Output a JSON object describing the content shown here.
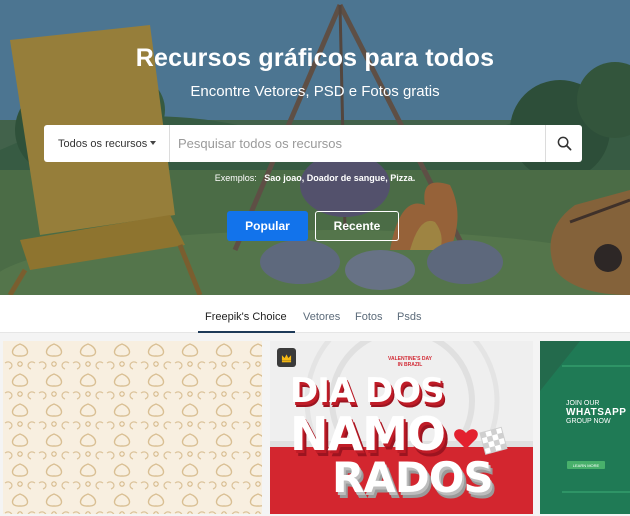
{
  "hero": {
    "title": "Recursos gráficos para todos",
    "subtitle": "Encontre Vetores, PSD e Fotos gratis"
  },
  "search": {
    "category": "Todos os recursos",
    "placeholder": "Pesquisar todos os recursos",
    "icon": "search-icon"
  },
  "examples": {
    "label": "Exemplos:",
    "items": "Sao joao, Doador de sangue, Pizza."
  },
  "buttons": {
    "popular": "Popular",
    "recent": "Recente"
  },
  "tabs": [
    {
      "label": "Freepik's Choice",
      "active": true
    },
    {
      "label": "Vetores",
      "active": false
    },
    {
      "label": "Fotos",
      "active": false
    },
    {
      "label": "Psds",
      "active": false
    }
  ],
  "cards": {
    "card2": {
      "premium_icon": "crown-icon",
      "caption_line1": "VALENTINE'S DAY",
      "caption_line2": "IN BRAZIL",
      "headline_1": "DIA DOS",
      "headline_2": "NAMO",
      "headline_3": "RADOS"
    },
    "card3": {
      "caption_line1": "JOIN OUR",
      "caption_line2": "WHATSAPP",
      "caption_line3": "GROUP NOW",
      "button": "LEARN MORE"
    }
  },
  "colors": {
    "primary_button": "#1273eb",
    "tab_active_underline": "#1d3a59",
    "valentine_red": "#d22a35",
    "whatsapp_green": "#1f7a55"
  }
}
